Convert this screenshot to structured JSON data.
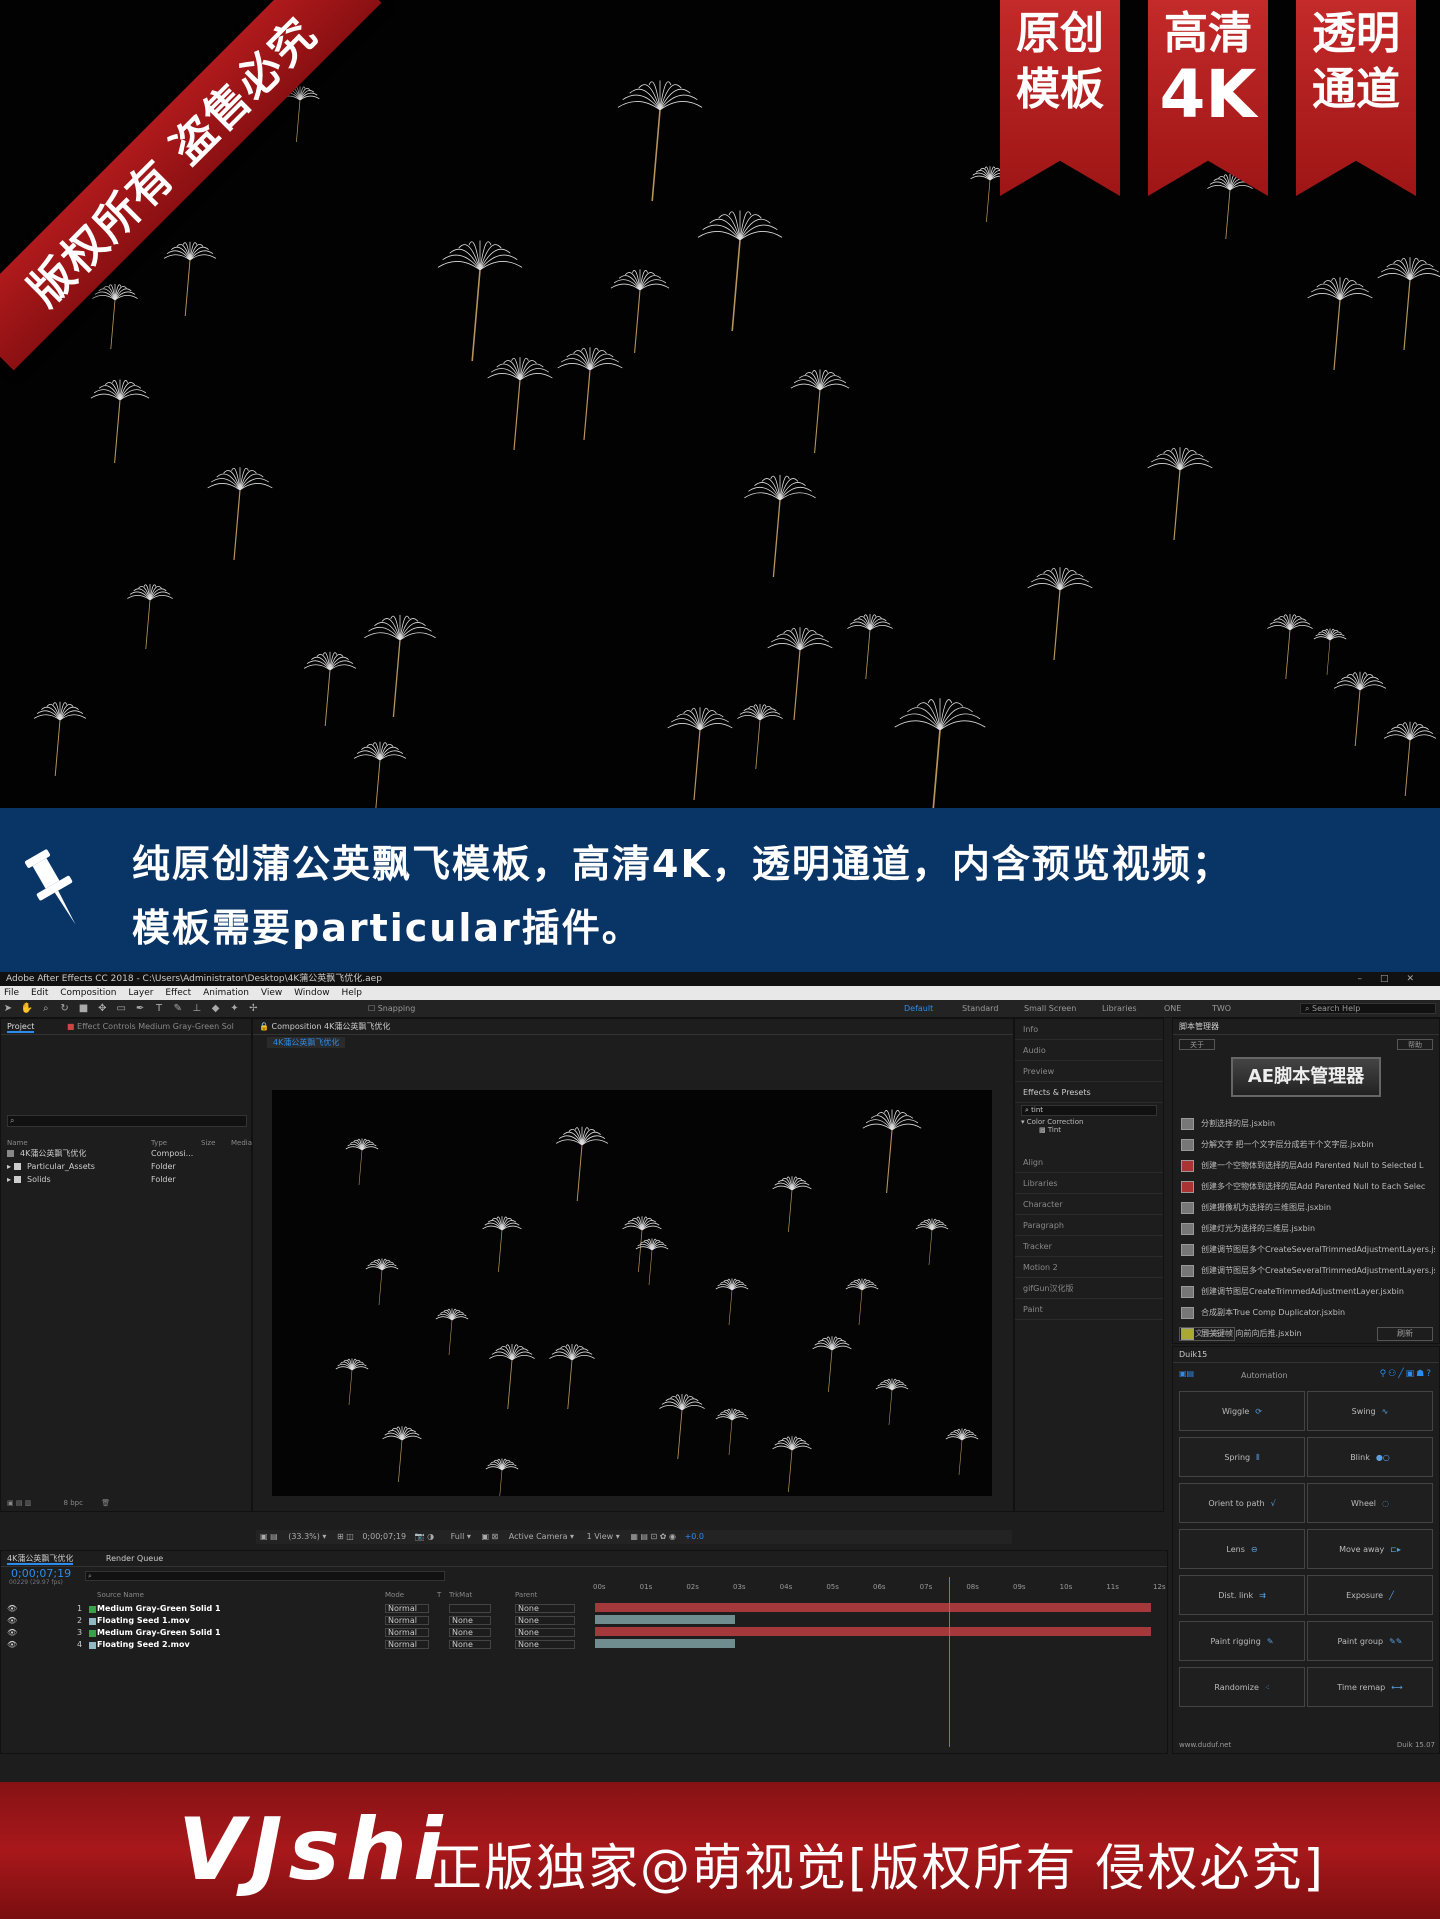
{
  "hero": {
    "corner_ribbon": "版权所有 盗售必究",
    "badges": [
      {
        "line1": "原创",
        "line2": "模板"
      },
      {
        "line1": "高清",
        "line2": "4K"
      },
      {
        "line1": "透明",
        "line2": "通道"
      }
    ]
  },
  "banner": {
    "line1": "纯原创蒲公英飘飞模板，高清4K，透明通道，内含预览视频；",
    "line2": "模板需要particular插件。",
    "icon": "pushpin-icon"
  },
  "app": {
    "title": "Adobe After Effects CC 2018 - C:\\Users\\Administrator\\Desktop\\4K蒲公英飘飞优化.aep",
    "menu": [
      "File",
      "Edit",
      "Composition",
      "Layer",
      "Effect",
      "Animation",
      "View",
      "Window",
      "Help"
    ],
    "snapping": "Snapping",
    "workspaces": [
      "Default",
      "Standard",
      "Small Screen",
      "Libraries",
      "ONE",
      "TWO"
    ],
    "search_help": "Search Help",
    "project": {
      "tab": "Project",
      "effect_controls": "Effect Controls Medium Gray-Green Sol",
      "col_name": "Name",
      "col_type": "Type",
      "col_size": "Size",
      "col_media": "Media",
      "items": [
        {
          "name": "4K蒲公英飘飞优化",
          "type": "Composi..."
        },
        {
          "name": "Particular_Assets",
          "type": "Folder"
        },
        {
          "name": "Solids",
          "type": "Folder"
        }
      ],
      "bpc": "8 bpc"
    },
    "composition": {
      "tab": "Composition 4K蒲公英飘飞优化",
      "crumb": "4K蒲公英飘飞优化",
      "zoom": "(33.3%)",
      "timecode": "0;00;07;19",
      "resolution": "Full",
      "camera": "Active Camera",
      "views": "1 View",
      "exposure": "+0.0"
    },
    "right_panels": [
      "Info",
      "Audio",
      "Preview",
      "Effects & Presets"
    ],
    "effects_search": "tint",
    "effects_category": "Color Correction",
    "effects_item": "Tint",
    "right_panels2": [
      "Align",
      "Libraries",
      "Character",
      "Paragraph",
      "Tracker",
      "Motion 2",
      "gifGun汉化版",
      "Paint"
    ],
    "script_manager": {
      "tab": "脚本管理器",
      "about": "关于",
      "help": "帮助",
      "logo": "AE脚本管理器",
      "scripts": [
        "分割选择的层.jsxbin",
        "分解文字 把一个文字层分成若干个文字层.jsxbin",
        "创建一个空物体到选择的层Add Parented Null to Selected L",
        "创建多个空物体到选择的层Add Parented Null to Each Selec",
        "创建摄像机为选择的三维图层.jsxbin",
        "创建灯光为选择的三维层.jsxbin",
        "创建调节图层多个CreateSeveralTrimmedAdjustmentLayers.js",
        "创建调节图层多个CreateSeveralTrimmedAdjustmentLayers.js",
        "创建调节图层CreateTrimmedAdjustmentLayer.jsxbin",
        "合成副本True Comp Duplicator.jsxbin",
        "层关键帧 向前向后推.jsxbin"
      ],
      "folder": "文件夹",
      "refresh": "刷新"
    },
    "duik": {
      "tab": "Duik15",
      "section": "Automation",
      "buttons": [
        "Wiggle",
        "Swing",
        "Spring",
        "Blink",
        "Orient to path",
        "Wheel",
        "Lens",
        "Move away",
        "Dist. link",
        "Exposure",
        "Paint rigging",
        "Paint group",
        "Randomize",
        "Time remap"
      ],
      "site": "www.duduf.net",
      "version": "Duik 15.07"
    },
    "timeline": {
      "tab": "4K蒲公英飘飞优化",
      "render_queue": "Render Queue",
      "timecode": "0;00;07;19",
      "fps": "00229 (29.97 fps)",
      "col_source": "Source Name",
      "col_mode": "Mode",
      "col_t": "T",
      "col_trkmat": "TrkMat",
      "col_parent": "Parent",
      "ruler": [
        "00s",
        "01s",
        "02s",
        "03s",
        "04s",
        "05s",
        "06s",
        "07s",
        "08s",
        "09s",
        "10s",
        "11s",
        "12s"
      ],
      "layers": [
        {
          "num": "1",
          "name": "Medium Gray-Green Solid 1",
          "mode": "Normal",
          "trkmat": "",
          "parent": "None",
          "color": "#3aa04a"
        },
        {
          "num": "2",
          "name": "Floating Seed 1.mov",
          "mode": "Normal",
          "trkmat": "None",
          "parent": "None",
          "color": "#8fb8c0"
        },
        {
          "num": "3",
          "name": "Medium Gray-Green Solid 1",
          "mode": "Normal",
          "trkmat": "None",
          "parent": "None",
          "color": "#3aa04a"
        },
        {
          "num": "4",
          "name": "Floating Seed 2.mov",
          "mode": "Normal",
          "trkmat": "None",
          "parent": "None",
          "color": "#8fb8c0"
        }
      ]
    }
  },
  "footer": {
    "logo": "VJshi",
    "text": "正版独家@萌视觉[版权所有 侵权必究]"
  },
  "colors": {
    "banner": "#093466",
    "ribbon": "#a8181b",
    "accent": "#2d8ceb"
  }
}
